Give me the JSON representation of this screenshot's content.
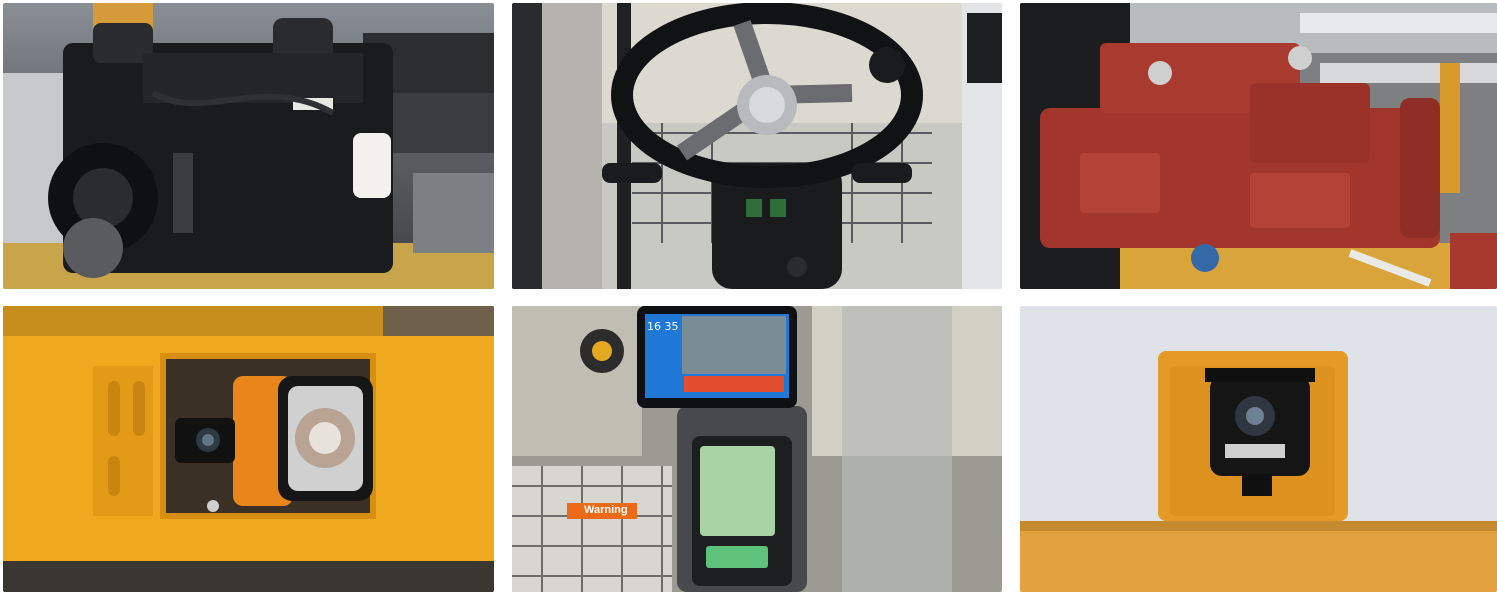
{
  "gallery": {
    "tiles": [
      {
        "subject": "diesel-engine"
      },
      {
        "subject": "steering-wheel"
      },
      {
        "subject": "hydraulic-pump"
      },
      {
        "subject": "work-light-with-camera"
      },
      {
        "subject": "cab-monitor-and-dashboard"
      },
      {
        "subject": "rear-camera"
      }
    ],
    "monitor": {
      "clock": "16 35"
    },
    "cab": {
      "warning_label": "Warning"
    },
    "colors": {
      "machine_yellow": "#f0a81e",
      "pump_red": "#a3362c",
      "engine_black": "#1a1b1d"
    }
  }
}
